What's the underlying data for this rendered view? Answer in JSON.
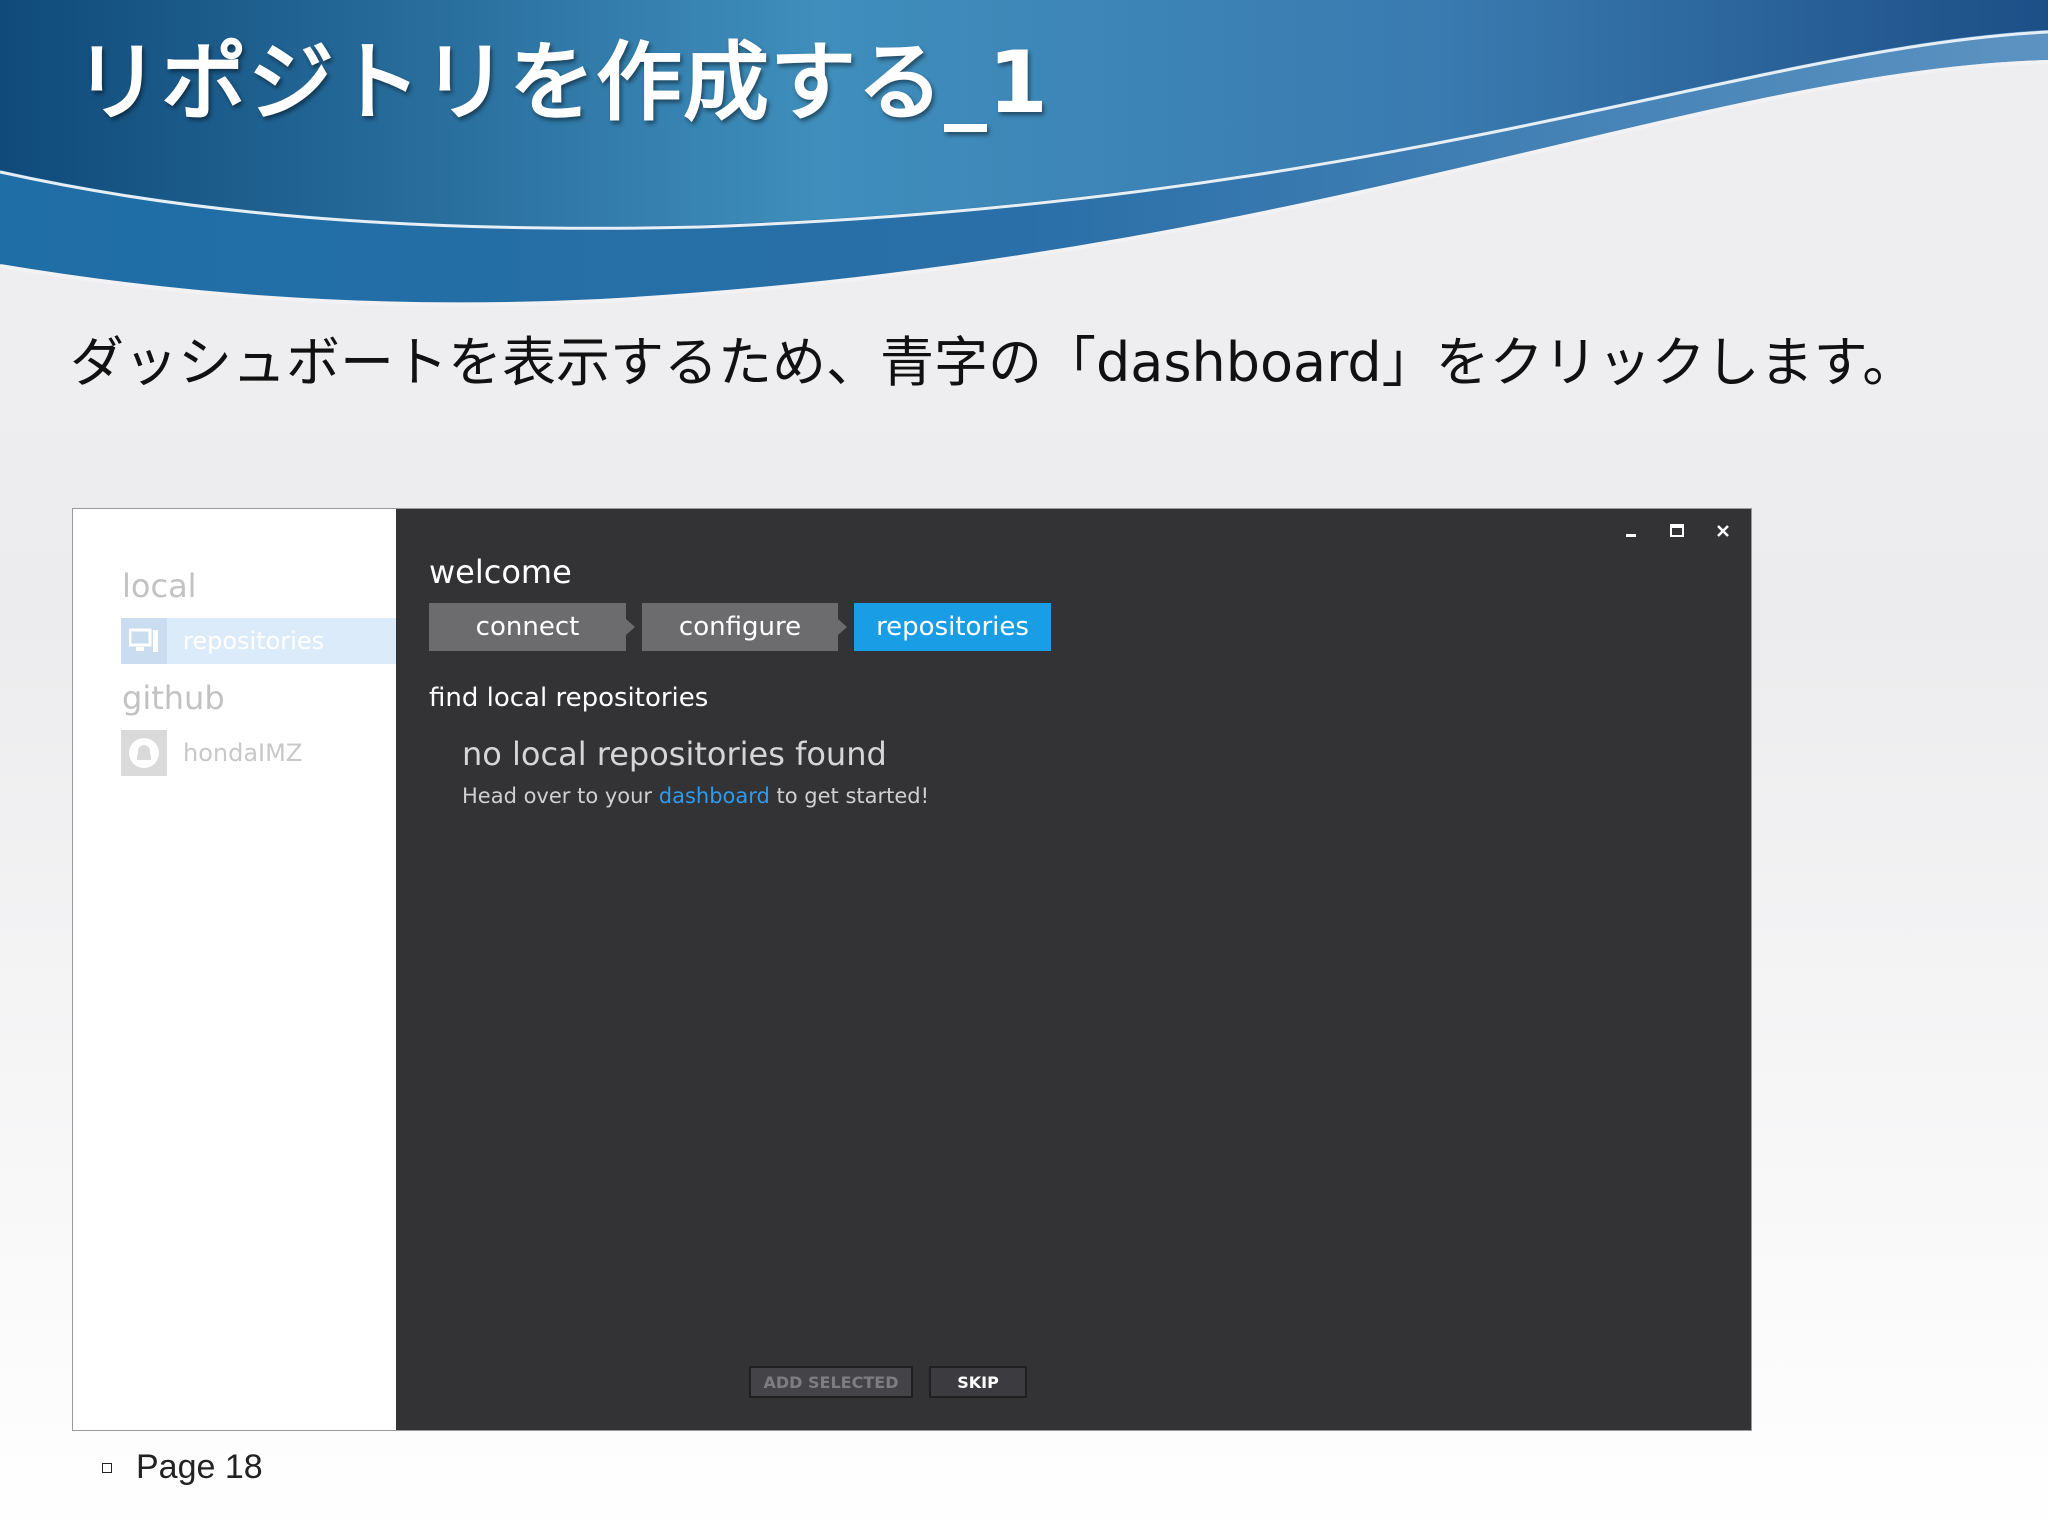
{
  "slide": {
    "title": "リポジトリを作成する_1",
    "instruction": "ダッシュボートを表示するため、青字の「dashboard」をクリックします。",
    "page_label": "Page 18"
  },
  "colors": {
    "banner_dark": "#0f4a7a",
    "banner_mid": "#3d86b4",
    "accent_blue": "#199ee6",
    "link_blue": "#2b9cf0",
    "app_bg": "#333235",
    "step_inactive": "#6c6b6e"
  },
  "app": {
    "sidebar": {
      "sections": [
        {
          "label": "local",
          "items": [
            {
              "label": "repositories",
              "icon": "computer-icon",
              "selected": true
            }
          ]
        },
        {
          "label": "github",
          "items": [
            {
              "label": "hondaIMZ",
              "icon": "github-octocat-icon",
              "selected": false
            }
          ]
        }
      ]
    },
    "window_controls": [
      "minimize-icon",
      "maximize-icon",
      "close-icon"
    ],
    "main": {
      "heading": "welcome",
      "steps": [
        {
          "label": "connect",
          "active": false
        },
        {
          "label": "configure",
          "active": false
        },
        {
          "label": "repositories",
          "active": true
        }
      ],
      "section_title": "find local repositories",
      "empty_state": {
        "title": "no local repositories found",
        "text_before": "Head over to your",
        "link": "dashboard",
        "text_after": "to get started!"
      },
      "buttons": {
        "add_selected": "ADD SELECTED",
        "skip": "SKIP"
      }
    }
  }
}
